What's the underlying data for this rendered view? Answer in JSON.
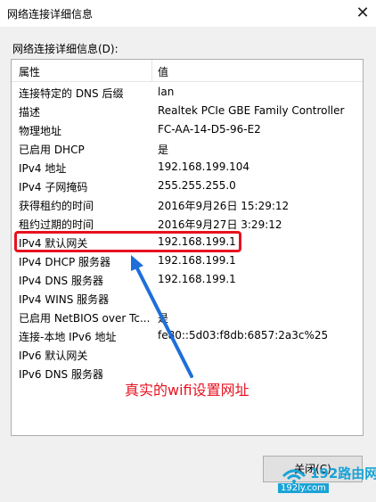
{
  "window": {
    "title": "网络连接详细信息",
    "close_glyph": "✕"
  },
  "section_label": "网络连接详细信息(D):",
  "table": {
    "headers": [
      "属性",
      "值"
    ],
    "rows": [
      {
        "key": "连接特定的 DNS 后缀",
        "value": "lan"
      },
      {
        "key": "描述",
        "value": "Realtek PCIe GBE Family Controller"
      },
      {
        "key": "物理地址",
        "value": "FC-AA-14-D5-96-E2"
      },
      {
        "key": "已启用 DHCP",
        "value": "是"
      },
      {
        "key": "IPv4 地址",
        "value": "192.168.199.104"
      },
      {
        "key": "IPv4 子网掩码",
        "value": "255.255.255.0"
      },
      {
        "key": "获得租约的时间",
        "value": "2016年9月26日 15:29:12"
      },
      {
        "key": "租约过期的时间",
        "value": "2016年9月27日 3:29:12"
      },
      {
        "key": "IPv4 默认网关",
        "value": "192.168.199.1"
      },
      {
        "key": "IPv4 DHCP 服务器",
        "value": "192.168.199.1"
      },
      {
        "key": "IPv4 DNS 服务器",
        "value": "192.168.199.1"
      },
      {
        "key": "IPv4 WINS 服务器",
        "value": ""
      },
      {
        "key": "已启用 NetBIOS over Tc...",
        "value": "是"
      },
      {
        "key": "连接-本地 IPv6 地址",
        "value": "fe80::5d03:f8db:6857:2a3c%25"
      },
      {
        "key": "IPv6 默认网关",
        "value": ""
      },
      {
        "key": "IPv6 DNS 服务器",
        "value": ""
      }
    ]
  },
  "annotation": {
    "text": "真实的wifi设置网址",
    "color": "#e8111f"
  },
  "close_button_label": "关闭(C)",
  "watermark": {
    "top": "192路由网",
    "bottom": "192ly.com"
  },
  "colors": {
    "accent_red": "#e8111f",
    "arrow_blue": "#1e6fd9",
    "watermark_blue": "#1aa3d6"
  }
}
